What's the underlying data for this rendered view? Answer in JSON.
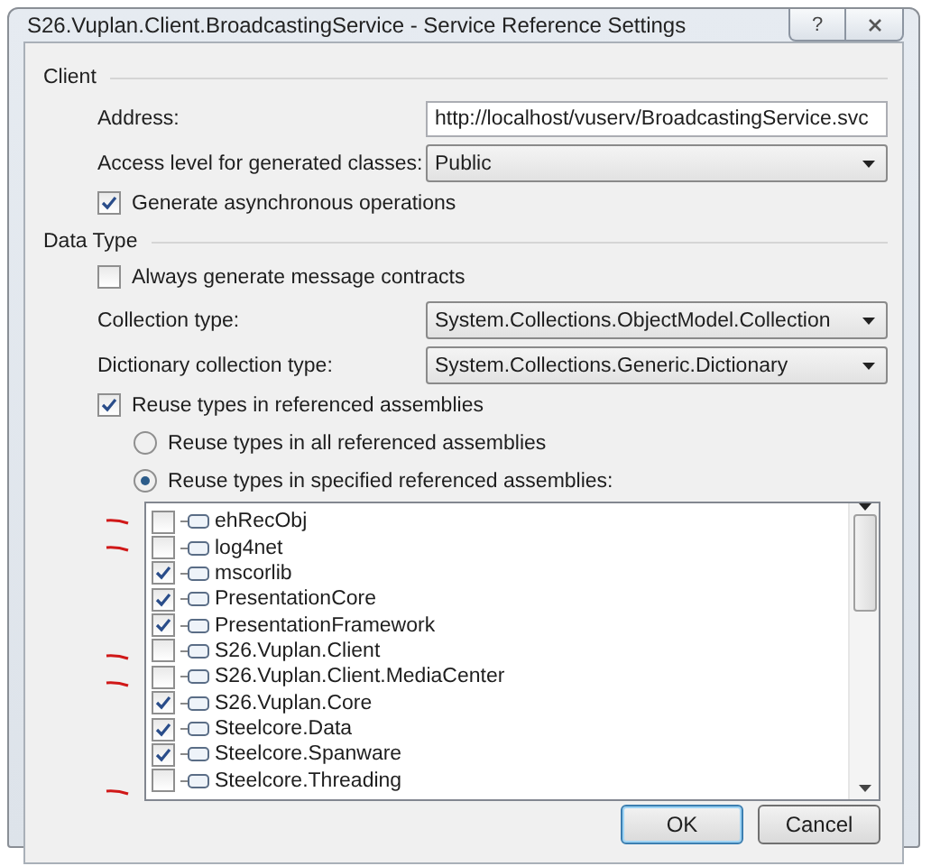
{
  "window": {
    "title": "S26.Vuplan.Client.BroadcastingService - Service Reference Settings",
    "help_button": "?"
  },
  "client": {
    "heading": "Client",
    "address": {
      "label": "Address:",
      "value": "http://localhost/vuserv/BroadcastingService.svc"
    },
    "access_level": {
      "label": "Access level for generated classes:",
      "value": "Public"
    },
    "generate_async": {
      "label": "Generate asynchronous operations",
      "checked": true
    }
  },
  "data_type": {
    "heading": "Data Type",
    "always_generate": {
      "label": "Always generate message contracts",
      "checked": false
    },
    "collection_type": {
      "label": "Collection type:",
      "value": "System.Collections.ObjectModel.Collection"
    },
    "dictionary_type": {
      "label": "Dictionary collection type:",
      "value": "System.Collections.Generic.Dictionary"
    },
    "reuse_types": {
      "label": "Reuse types in referenced assemblies",
      "checked": true
    },
    "reuse_options": [
      {
        "label": "Reuse types in all referenced assemblies",
        "selected": false
      },
      {
        "label": "Reuse types in specified referenced assemblies:",
        "selected": true
      }
    ],
    "assemblies": [
      {
        "name": "ehRecObj",
        "checked": false,
        "marked": true
      },
      {
        "name": "log4net",
        "checked": false,
        "marked": true
      },
      {
        "name": "mscorlib",
        "checked": true,
        "marked": false
      },
      {
        "name": "PresentationCore",
        "checked": true,
        "marked": false
      },
      {
        "name": "PresentationFramework",
        "checked": true,
        "marked": false
      },
      {
        "name": "S26.Vuplan.Client",
        "checked": false,
        "marked": true
      },
      {
        "name": "S26.Vuplan.Client.MediaCenter",
        "checked": false,
        "marked": true
      },
      {
        "name": "S26.Vuplan.Core",
        "checked": true,
        "marked": false
      },
      {
        "name": "Steelcore.Data",
        "checked": true,
        "marked": false
      },
      {
        "name": "Steelcore.Spanware",
        "checked": true,
        "marked": false
      },
      {
        "name": "Steelcore.Threading",
        "checked": false,
        "marked": true
      }
    ]
  },
  "buttons": [
    {
      "label": "OK",
      "default": true
    },
    {
      "label": "Cancel",
      "default": false
    }
  ]
}
